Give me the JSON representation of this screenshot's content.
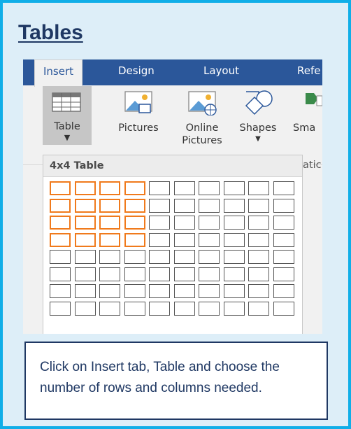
{
  "page": {
    "heading": "Tables",
    "instruction": "Click on Insert tab, Table and choose the number of rows and columns needed."
  },
  "ribbon": {
    "tabs": [
      {
        "label": "Insert",
        "active": true
      },
      {
        "label": "Design",
        "active": false
      },
      {
        "label": "Layout",
        "active": false
      },
      {
        "label": "Refe",
        "active": false
      }
    ],
    "commands": {
      "table": "Table",
      "pictures": "Pictures",
      "online_pictures_line1": "Online",
      "online_pictures_line2": "Pictures",
      "shapes": "Shapes",
      "smartart_partial": "Sma"
    },
    "group_label_partial": "atic"
  },
  "table_dropdown": {
    "title": "4x4 Table",
    "grid_columns": 10,
    "grid_rows": 8,
    "selected_columns": 4,
    "selected_rows": 4
  },
  "colors": {
    "border": "#10aee8",
    "card_background": "#ddeef8",
    "heading": "#1f3863",
    "tab_bar": "#2b579a",
    "selection": "#f07a1c"
  },
  "icons": [
    "table-icon",
    "pictures-icon",
    "online-pictures-icon",
    "shapes-icon",
    "smartart-icon",
    "dropdown-arrow-icon"
  ]
}
